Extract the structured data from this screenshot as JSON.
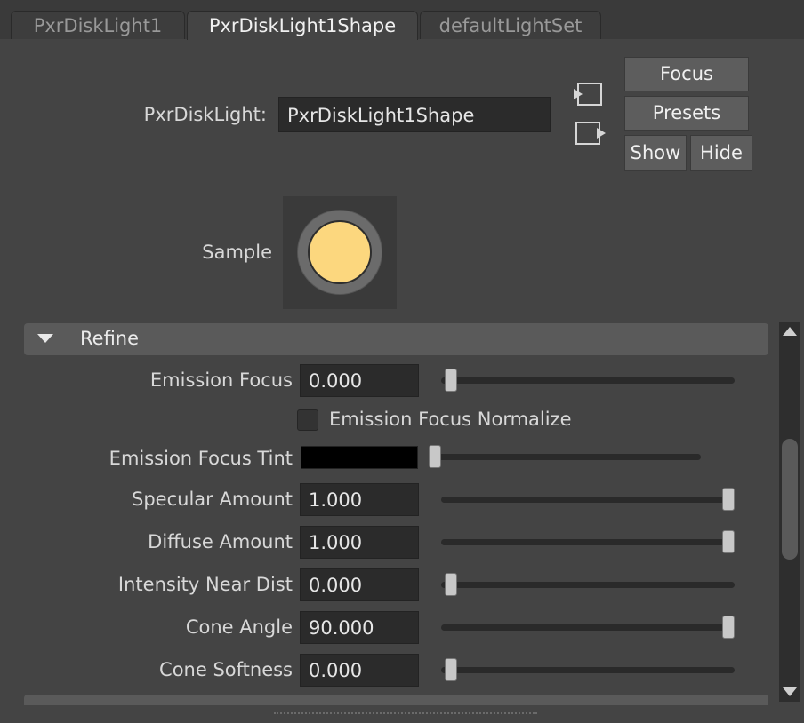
{
  "tabs": [
    {
      "label": "PxrDiskLight1",
      "active": false
    },
    {
      "label": "PxrDiskLight1Shape",
      "active": true
    },
    {
      "label": "defaultLightSet",
      "active": false
    }
  ],
  "node": {
    "type_label": "PxrDiskLight:",
    "name_value": "PxrDiskLight1Shape"
  },
  "buttons": {
    "focus": "Focus",
    "presets": "Presets",
    "show": "Show",
    "hide": "Hide"
  },
  "icons": {
    "input_connection": "input-connection-icon",
    "output_connection": "output-connection-icon"
  },
  "sample": {
    "label": "Sample",
    "swatch_color": "#fcd77e"
  },
  "refine": {
    "title": "Refine",
    "collapsed": false,
    "attributes": [
      {
        "label": "Emission Focus",
        "value": "0.000",
        "slider_fraction": 0.0
      },
      {
        "label": "Emission Focus Normalize",
        "type": "checkbox",
        "checked": false
      },
      {
        "label": "Emission Focus Tint",
        "type": "color",
        "color": "#000000",
        "slider_fraction": 0.0
      },
      {
        "label": "Specular Amount",
        "value": "1.000",
        "slider_fraction": 1.0
      },
      {
        "label": "Diffuse Amount",
        "value": "1.000",
        "slider_fraction": 1.0
      },
      {
        "label": "Intensity Near Dist",
        "value": "0.000",
        "slider_fraction": 0.0
      },
      {
        "label": "Cone Angle",
        "value": "90.000",
        "slider_fraction": 1.0
      },
      {
        "label": "Cone Softness",
        "value": "0.000",
        "slider_fraction": 0.0
      }
    ]
  },
  "colors": {
    "background": "#444444",
    "section_header": "#5a5a5a",
    "field": "#2b2b2b",
    "button": "#5d5d5d"
  }
}
